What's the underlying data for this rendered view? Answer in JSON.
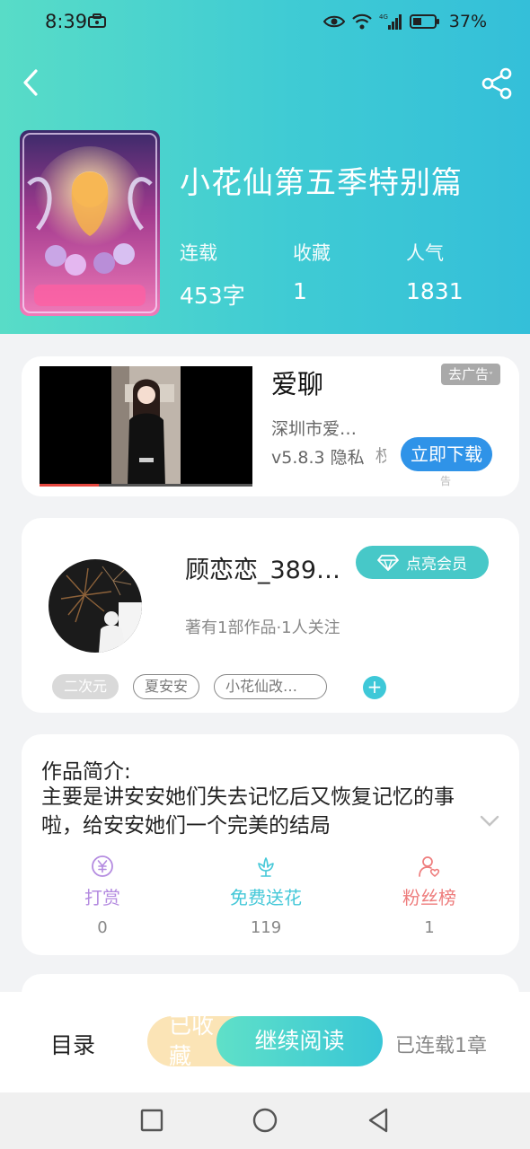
{
  "status": {
    "time": "8:39",
    "network": "4G",
    "battery": "37%"
  },
  "book": {
    "title": "小花仙第五季特别篇",
    "stats": [
      {
        "label": "连载",
        "value": "453字"
      },
      {
        "label": "收藏",
        "value": "1"
      },
      {
        "label": "人气",
        "value": "1831"
      }
    ]
  },
  "ad": {
    "app_name": "爱聊",
    "tag": "去广告",
    "company": "深圳市爱…",
    "version": "v5.8.3  隐私",
    "clip_text": "权限",
    "download": "立即下载",
    "small": "告"
  },
  "author": {
    "name": "顾恋恋_389…",
    "vip_label": "点亮会员",
    "meta": "著有1部作品·1人关注",
    "tags": [
      "二次元",
      "夏安安",
      "小花仙改…"
    ],
    "add_icon": "+"
  },
  "intro": {
    "label": "作品简介:",
    "text": "主要是讲安安她们失去记忆后又恢复记忆的事啦，给安安她们一个完美的结局"
  },
  "actions": [
    {
      "label": "打赏",
      "count": "0",
      "color": "#b48be0",
      "icon": "yen-coin-icon"
    },
    {
      "label": "免费送花",
      "count": "119",
      "color": "#45c8d8",
      "icon": "flower-icon"
    },
    {
      "label": "粉丝榜",
      "count": "1",
      "color": "#ee7d7d",
      "icon": "fan-heart-icon"
    }
  ],
  "bottom": {
    "toc": "目录",
    "collected": "已收藏",
    "continue": "继续阅读",
    "serial": "已连载1章"
  }
}
